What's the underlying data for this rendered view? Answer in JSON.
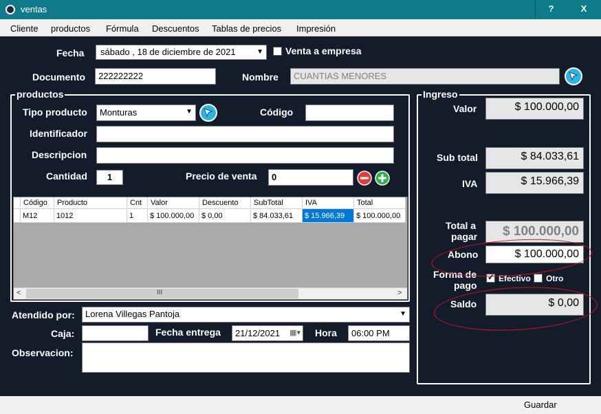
{
  "window": {
    "title": "ventas",
    "help_label": "?",
    "close_label": "X"
  },
  "menu": [
    "Cliente",
    "productos",
    "Fórmula",
    "Descuentos",
    "Tablas de precios",
    "Impresión"
  ],
  "header": {
    "fecha_label": "Fecha",
    "fecha_value": "sábado , 18 de  diciembre  de 2021",
    "venta_empresa_label": "Venta a empresa",
    "venta_empresa_checked": false,
    "documento_label": "Documento",
    "documento_value": "222222222",
    "nombre_label": "Nombre",
    "nombre_value": "CUANTIAS MENORES"
  },
  "productos": {
    "title": "productos",
    "tipo_label": "Tipo producto",
    "tipo_value": "Monturas",
    "codigo_label": "Código",
    "codigo_value": "",
    "identificador_label": "Identificador",
    "identificador_value": "",
    "descripcion_label": "Descripcion",
    "descripcion_value": "",
    "cantidad_label": "Cantidad",
    "cantidad_value": "1",
    "precio_label": "Precio de venta",
    "precio_value": "0",
    "remove_icon": "minus-circle-icon",
    "add_icon": "plus-circle-icon"
  },
  "grid": {
    "columns": [
      "Código",
      "Producto",
      "Cnt",
      "Valor",
      "Descuento",
      "SubTotal",
      "IVA",
      "Total"
    ],
    "rows": [
      [
        "M12",
        "1012",
        "1",
        "$ 100.000,00",
        "$ 0,00",
        "$ 84.033,61",
        "$ 15.966,39",
        "$ 100.000,00"
      ]
    ],
    "scroll_mid": "III"
  },
  "footer": {
    "atendido_label": "Atendido por:",
    "atendido_value": "Lorena Villegas Pantoja",
    "caja_label": "Caja:",
    "caja_value": "",
    "fecha_entrega_label": "Fecha entrega",
    "fecha_entrega_value": "21/12/2021",
    "hora_label": "Hora",
    "hora_value": "06:00 PM",
    "observacion_label": "Observacion:",
    "observacion_value": ""
  },
  "ingreso": {
    "title": "Ingreso",
    "valor_label": "Valor",
    "valor_value": "$ 100.000,00",
    "subtotal_label": "Sub total",
    "subtotal_value": "$ 84.033,61",
    "iva_label": "IVA",
    "iva_value": "$ 15.966,39",
    "total_label_1": "Total a",
    "total_label_2": "pagar",
    "total_value": "$ 100.000,00",
    "abono_label": "Abono",
    "abono_value": "$ 100.000,00",
    "forma_label_1": "Forma de",
    "forma_label_2": "pago",
    "efectivo_label": "Efectivo",
    "efectivo_checked": true,
    "otro_label": "Otro",
    "otro_checked": false,
    "saldo_label": "Saldo",
    "saldo_value": "$ 0,00"
  },
  "status": {
    "guardar_label": "Guardar"
  },
  "colors": {
    "background": "#141b2b",
    "titlebar": "#0f7b8a",
    "selection": "#0078d7",
    "annotation": "#d01818"
  }
}
